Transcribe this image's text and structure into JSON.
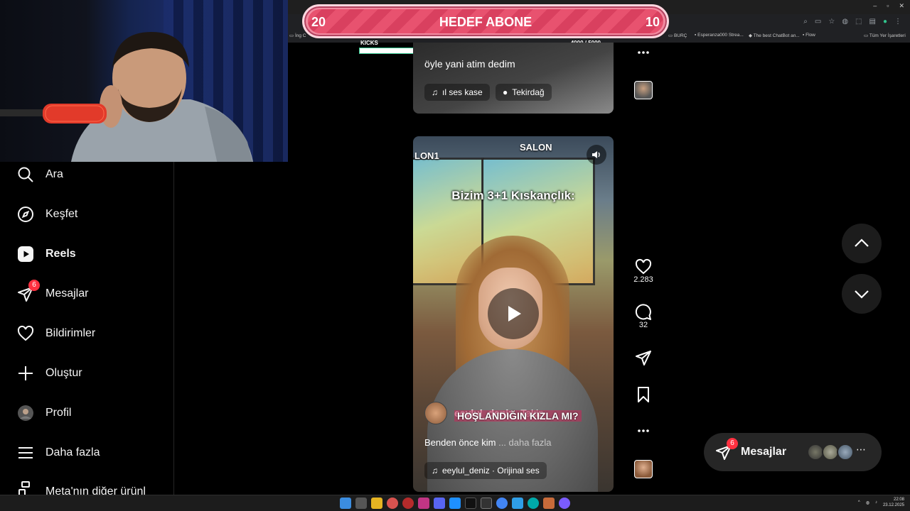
{
  "overlay": {
    "goal_left": "20",
    "goal_title": "HEDEF ABONE",
    "goal_right": "10",
    "kicks_label": "KICKS",
    "kicks_count": "4000  / 5000",
    "kicks_progress": 0.8
  },
  "browser": {
    "bookmarks": [
      "İng C",
      "BURÇ",
      "Esperanza000 Strea...",
      "The best ChatBot an...",
      "Flow",
      "Tüm Yer İşaretleri"
    ],
    "window_controls": [
      "–",
      "▫",
      "✕"
    ]
  },
  "sidebar": {
    "items": [
      {
        "label": "Ara",
        "icon": "search-icon"
      },
      {
        "label": "Keşfet",
        "icon": "compass-icon"
      },
      {
        "label": "Reels",
        "icon": "reels-icon"
      },
      {
        "label": "Mesajlar",
        "icon": "messenger-icon",
        "badge": "6"
      },
      {
        "label": "Bildirimler",
        "icon": "heart-icon"
      },
      {
        "label": "Oluştur",
        "icon": "plus-icon"
      },
      {
        "label": "Profil",
        "icon": "profile-avatar"
      },
      {
        "label": "Daha fazla",
        "icon": "menu-icon"
      },
      {
        "label": "Meta'nın diğer ürünl",
        "icon": "meta-icon"
      }
    ]
  },
  "reel_top": {
    "caption": "öyle yani atim dedim",
    "audio": "ıl ses  kase",
    "location": "Tekirdağ"
  },
  "reel_main": {
    "poster_text": "SALON",
    "poster_text_left": "LON1",
    "overlay_text": "Bizim 3+1 Kıskançlık:",
    "pink_caption": "HOŞLANDIĞIN KIZLA MI?",
    "author": "eeylul_deniz",
    "follow": "Takip",
    "description": "Benden önce kim",
    "more": "... daha fazla",
    "audio": "eeylul_deniz · Orijinal ses",
    "likes": "2.283",
    "comments": "32"
  },
  "messages_pill": {
    "label": "Mesajlar",
    "badge": "6"
  },
  "taskbar": {
    "time": "22:08",
    "date": "23.12.2025"
  },
  "colors": {
    "accent_red": "#ff3040",
    "goal_pink": "#e8526f",
    "kicks_green": "#31c48d"
  }
}
